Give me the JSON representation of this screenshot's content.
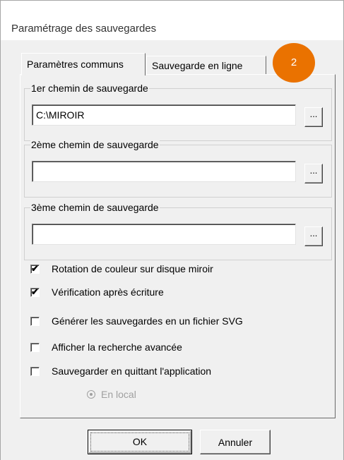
{
  "window": {
    "title": "Paramétrage des sauvegardes"
  },
  "tabs": [
    {
      "label": "Paramètres communs",
      "active": true
    },
    {
      "label": "Sauvegarde en ligne",
      "active": false
    }
  ],
  "badge": {
    "text": "2",
    "color": "#ea7200"
  },
  "paths": [
    {
      "label": "1er chemin de sauvegarde",
      "value": "C:\\MIROIR",
      "browse_label": "..."
    },
    {
      "label": "2ème chemin de sauvegarde",
      "value": "",
      "browse_label": "..."
    },
    {
      "label": "3ème chemin de sauvegarde",
      "value": "",
      "browse_label": "..."
    }
  ],
  "options": [
    {
      "label": "Rotation de couleur sur disque miroir",
      "checked": true
    },
    {
      "label": "Vérification après écriture",
      "checked": true
    },
    {
      "label": "Générer les sauvegardes en un fichier SVG",
      "checked": false
    },
    {
      "label": "Afficher la recherche avancée",
      "checked": false
    },
    {
      "label": "Sauvegarder en quittant l'application",
      "checked": false
    }
  ],
  "radio": {
    "label": "En local",
    "selected": true,
    "disabled": true
  },
  "buttons": {
    "ok": "OK",
    "cancel": "Annuler"
  }
}
